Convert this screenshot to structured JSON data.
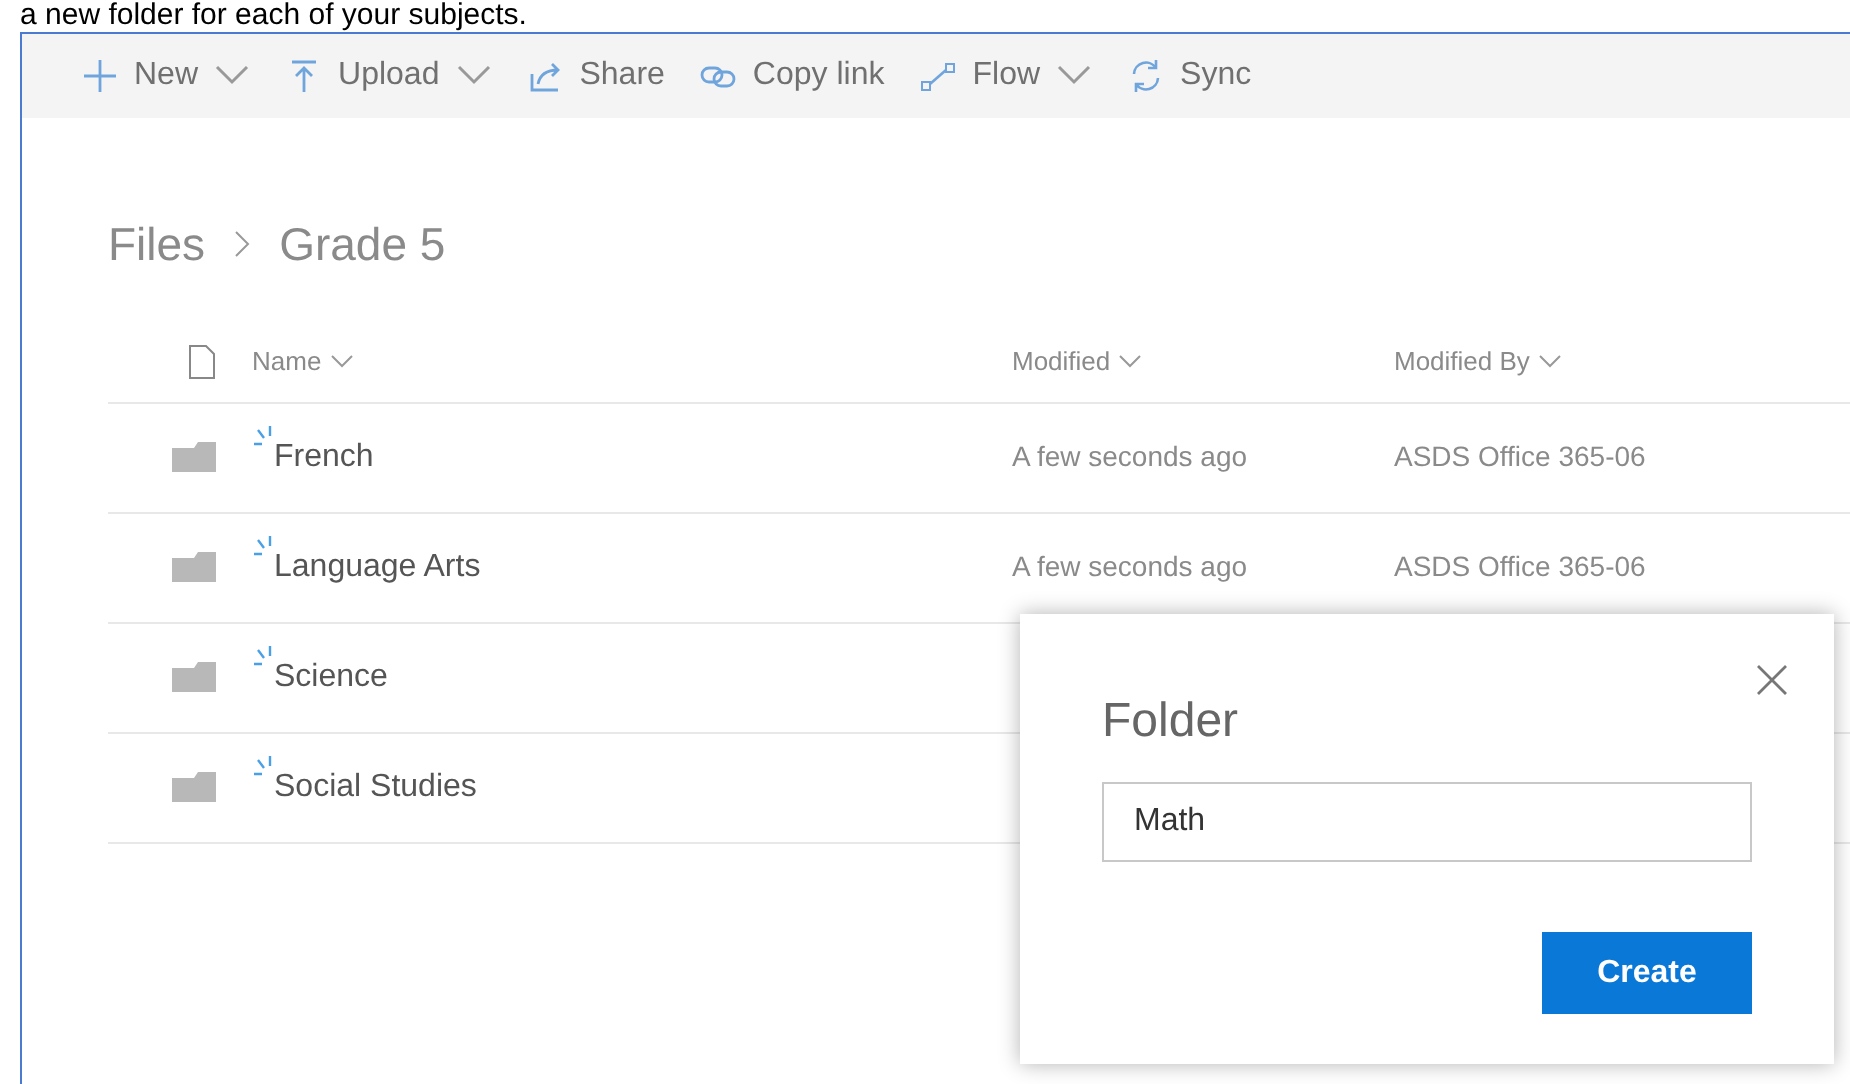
{
  "caption": "a new folder for each of your subjects.",
  "toolbar": [
    {
      "label": "New",
      "dropdown": true
    },
    {
      "label": "Upload",
      "dropdown": true
    },
    {
      "label": "Share",
      "dropdown": false
    },
    {
      "label": "Copy link",
      "dropdown": false
    },
    {
      "label": "Flow",
      "dropdown": true
    },
    {
      "label": "Sync",
      "dropdown": false
    }
  ],
  "breadcrumb": [
    "Files",
    "Grade 5"
  ],
  "table": {
    "columns": [
      "Name",
      "Modified",
      "Modified By"
    ],
    "rows": [
      {
        "name": "French",
        "modified": "A few seconds ago",
        "modified_by": "ASDS Office 365-06"
      },
      {
        "name": "Language Arts",
        "modified": "A few seconds ago",
        "modified_by": "ASDS Office 365-06"
      },
      {
        "name": "Science"
      },
      {
        "name": "Social Studies"
      }
    ]
  },
  "dialog": {
    "title": "Folder",
    "value": "Math",
    "button": "Create"
  }
}
